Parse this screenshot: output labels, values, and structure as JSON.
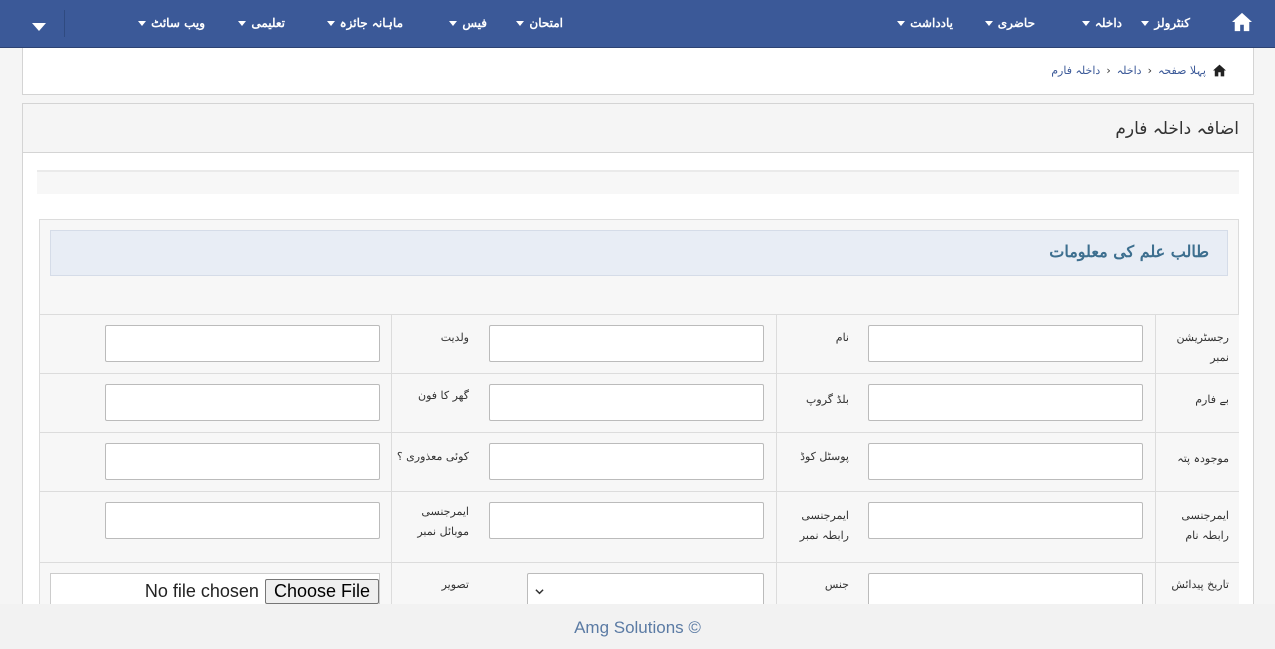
{
  "nav": {
    "menu": [
      {
        "label": "کنٹرولز"
      },
      {
        "label": "داخلہ"
      },
      {
        "label": "حاضری"
      },
      {
        "label": "یادداشت"
      },
      {
        "label": "امتحان"
      },
      {
        "label": "فیس"
      },
      {
        "label": "ماہانہ جائزہ"
      },
      {
        "label": "تعلیمی"
      },
      {
        "label": "ویب سائٹ"
      }
    ],
    "home_icon": "home-icon",
    "toggle_icon": "caret-down-icon"
  },
  "breadcrumb": {
    "home": "پہلا صفحہ",
    "section": "داخلہ",
    "current": "داخلہ فارم"
  },
  "page": {
    "title": "اضافہ داخلہ فارم"
  },
  "section": {
    "title": "طالب علم کی معلومات"
  },
  "form": {
    "rows": [
      {
        "c1": "رجسٹریشن نمبر",
        "c2": "نام",
        "c3": "ولدیت"
      },
      {
        "c1": "بے فارم",
        "c2": "بلڈ گروپ",
        "c3": "گھر کا فون"
      },
      {
        "c1": "موجودہ پتہ",
        "c2": "پوسٹل کوڈ",
        "c3": "کوئی معذوری ؟"
      },
      {
        "c1": "ایمرجنسی رابطہ نام",
        "c2": "ایمرجنسی رابطہ نمبر",
        "c3": "ایمرجنسی موبائل نمبر"
      },
      {
        "c1": "تاریخ پیدائش",
        "c2": "جنس",
        "c3": "تصویر"
      }
    ],
    "file": {
      "button": "Choose File",
      "status": "No file chosen"
    },
    "gender_value": ""
  },
  "footer": {
    "text": "Amg Solutions ©"
  },
  "colors": {
    "nav_bg": "#3b5998",
    "section_title": "#3d6f8f",
    "footer_text": "#5b7ba4"
  }
}
